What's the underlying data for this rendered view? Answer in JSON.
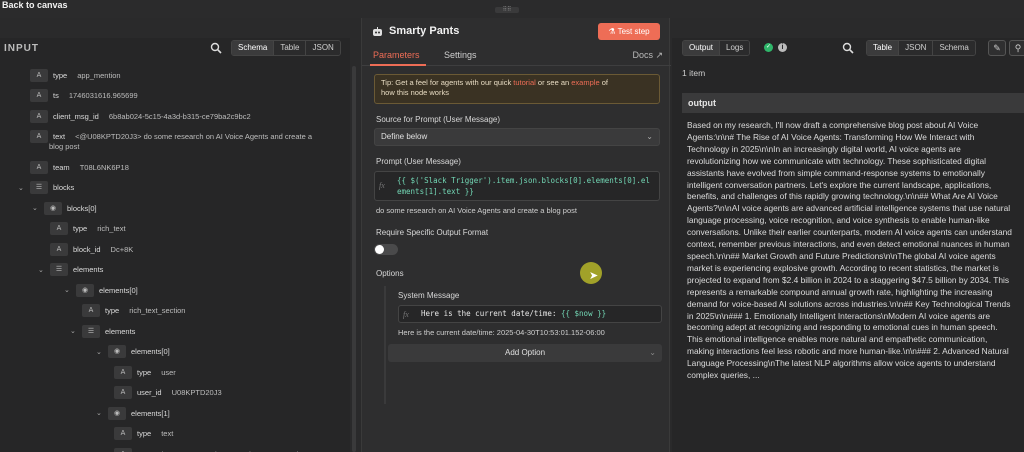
{
  "header": {
    "back_label": "Back to canvas",
    "drag_handle": "⠿⠿"
  },
  "input_panel": {
    "title": "INPUT",
    "view_tabs": [
      "Schema",
      "Table",
      "JSON"
    ],
    "active_view": "Schema",
    "tree": [
      {
        "badge": "A",
        "key": "type",
        "value": "app_mention"
      },
      {
        "badge": "A",
        "key": "ts",
        "value": "1746031616.965699"
      },
      {
        "badge": "A",
        "key": "client_msg_id",
        "value": "6b8ab024-5c15-4a3d-b315-ce79ba2c9bc2"
      },
      {
        "badge": "A",
        "key": "text",
        "value": "<@U08KPTD20J3> do some research on AI Voice Agents and create a",
        "value2": "blog post"
      },
      {
        "badge": "A",
        "key": "team",
        "value": "T08L6NK6P18"
      },
      {
        "badge": "☰",
        "key": "blocks",
        "value": ""
      },
      {
        "badge": "◉",
        "key": "blocks[0]",
        "value": ""
      },
      {
        "badge": "A",
        "key": "type",
        "value": "rich_text"
      },
      {
        "badge": "A",
        "key": "block_id",
        "value": "Dc+8K"
      },
      {
        "badge": "☰",
        "key": "elements",
        "value": ""
      },
      {
        "badge": "◉",
        "key": "elements[0]",
        "value": ""
      },
      {
        "badge": "A",
        "key": "type",
        "value": "rich_text_section"
      },
      {
        "badge": "☰",
        "key": "elements",
        "value": ""
      },
      {
        "badge": "◉",
        "key": "elements[0]",
        "value": ""
      },
      {
        "badge": "A",
        "key": "type",
        "value": "user"
      },
      {
        "badge": "A",
        "key": "user_id",
        "value": "U08KPTD20J3"
      },
      {
        "badge": "◉",
        "key": "elements[1]",
        "value": ""
      },
      {
        "badge": "A",
        "key": "type",
        "value": "text"
      },
      {
        "badge": "A",
        "key": "text",
        "value": "do some research on AI Voice Agents and"
      }
    ]
  },
  "node": {
    "title": "Smarty Pants",
    "test_button": "Test step",
    "tabs": [
      "Parameters",
      "Settings"
    ],
    "docs_label": "Docs ↗",
    "tip_pre": "Tip: Get a feel for agents with our quick ",
    "tip_link1": "tutorial",
    "tip_mid": " or see an ",
    "tip_link2": "example",
    "tip_post": " of",
    "tip_line2": "how this node works",
    "source_label": "Source for Prompt (User Message)",
    "source_value": "Define below",
    "prompt_label": "Prompt (User Message)",
    "prompt_expr_line1": "{{ $('Slack Trigger').item.json.blocks[0].elements[0].el",
    "prompt_expr_line2": "ements[1].text }}",
    "prompt_preview": "do some research on AI Voice Agents and create a blog post",
    "require_format_label": "Require Specific Output Format",
    "require_format_on": false,
    "options_label": "Options",
    "system_message_label": "System Message",
    "system_expr_text": "Here is the current date/time: ",
    "system_expr_var": "{{ $now }}",
    "system_preview": "Here is the current date/time: 2025-04-30T10:53:01.152-06:00",
    "add_option_label": "Add Option"
  },
  "output_panel": {
    "view_tabs": [
      "Output",
      "Logs"
    ],
    "active_tab": "Output",
    "format_tabs": [
      "Table",
      "JSON",
      "Schema"
    ],
    "active_format": "Table",
    "item_count": "1 item",
    "column_header": "output",
    "text": "Based on my research, I'll now draft a comprehensive blog post about AI Voice Agents:\\n\\n# The Rise of AI Voice Agents: Transforming How We Interact with Technology in 2025\\n\\nIn an increasingly digital world, AI voice agents are revolutionizing how we communicate with technology. These sophisticated digital assistants have evolved from simple command-response systems to emotionally intelligent conversation partners. Let's explore the current landscape, applications, benefits, and challenges of this rapidly growing technology.\\n\\n## What Are AI Voice Agents?\\n\\nAI voice agents are advanced artificial intelligence systems that use natural language processing, voice recognition, and voice synthesis to enable human-like conversations. Unlike their earlier counterparts, modern AI voice agents can understand context, remember previous interactions, and even detect emotional nuances in human speech.\\n\\n## Market Growth and Future Predictions\\n\\nThe global AI voice agents market is experiencing explosive growth. According to recent statistics, the market is projected to expand from $2.4 billion in 2024 to a staggering $47.5 billion by 2034. This represents a remarkable compound annual growth rate, highlighting the increasing demand for voice-based AI solutions across industries.\\n\\n## Key Technological Trends in 2025\\n\\n### 1. Emotionally Intelligent Interactions\\nModern AI voice agents are becoming adept at recognizing and responding to emotional cues in human speech. This emotional intelligence enables more natural and empathetic communication, making interactions feel less robotic and more human-like.\\n\\n### 2. Advanced Natural Language Processing\\nThe latest NLP algorithms allow voice agents to understand complex queries, ..."
  },
  "colors": {
    "accent": "#ee6d56",
    "success": "#2fb66a",
    "expression": "#72d6b4"
  }
}
